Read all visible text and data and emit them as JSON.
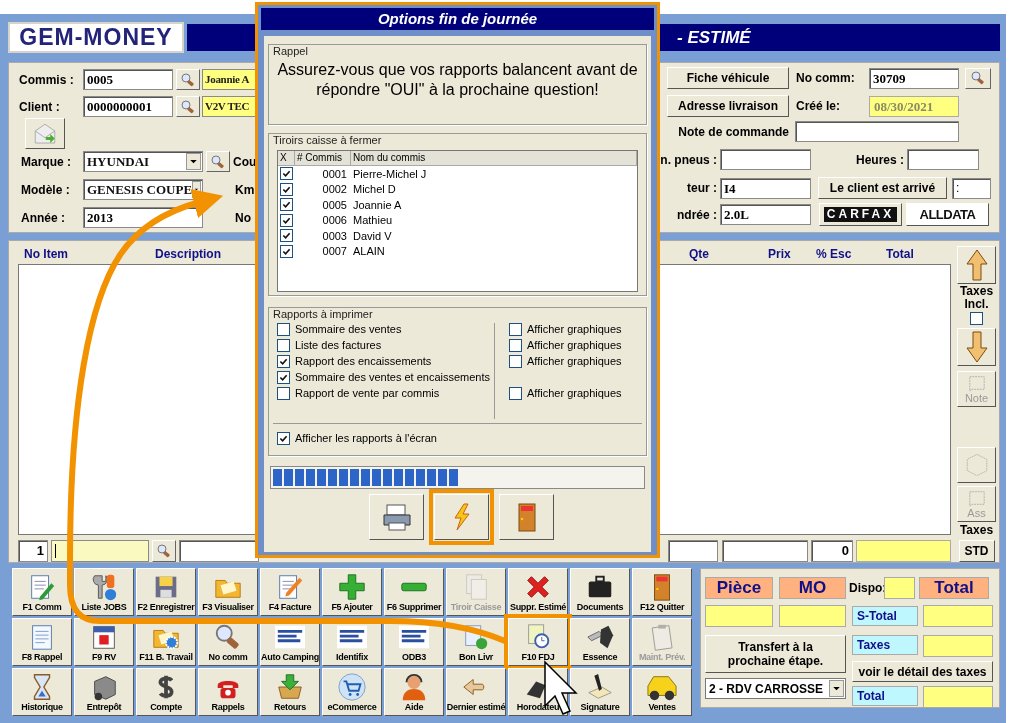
{
  "logo": {
    "text": "GEM-MONEY"
  },
  "title_bar": {
    "title": "- ESTIMÉ"
  },
  "left_form": {
    "commis": {
      "label": "Commis :",
      "value": "0005",
      "name": "Joannie A"
    },
    "client": {
      "label": "Client :",
      "value": "0000000001",
      "name": "V2V TEC"
    },
    "marque": {
      "label": "Marque :",
      "value": "HYUNDAI",
      "next_label": "Cou"
    },
    "modele": {
      "label": "Modèle :",
      "value": "GENESIS COUPE",
      "next_label": "Km"
    },
    "annee": {
      "label": "Année :",
      "value": "2013",
      "next_label": "No"
    }
  },
  "right_form": {
    "vehicle_button": "Fiche véhicule",
    "delivery_button": "Adresse livraison",
    "no_comm": {
      "label": "No comm:",
      "value": "30709"
    },
    "created": {
      "label": "Créé le:",
      "value": "08/30/2021"
    },
    "order_note": {
      "label": "Note de commande"
    },
    "tires": {
      "label": "n. pneus :"
    },
    "hours": {
      "label": "Heures :"
    },
    "engine": {
      "label": "teur :",
      "value": "I4"
    },
    "arrived_button": "Le client est arrivé",
    "arrived_time": ":",
    "displacement": {
      "label": "ndrée :",
      "value": "2.0L"
    },
    "carfax": "CARFAX",
    "alldata": "ALLDATA"
  },
  "items_table": {
    "columns_left": [
      "No Item",
      "Description"
    ],
    "columns_right": [
      "Qte",
      "Prix",
      "% Esc",
      "Total"
    ],
    "entry": {
      "line": "1",
      "discount_total": "0"
    }
  },
  "side_panel": {
    "taxes_incl": {
      "label": "Taxes Incl.",
      "checked": false
    },
    "note_button": {
      "label": "Note",
      "disabled": true
    },
    "ass_button": {
      "label": "Ass",
      "disabled": true
    },
    "taxes_label": "Taxes",
    "std_button": "STD"
  },
  "toolbar": [
    {
      "label": "F1 Comm",
      "disabled": false,
      "highlighted": false
    },
    {
      "label": "Liste JOBS",
      "disabled": false,
      "highlighted": false
    },
    {
      "label": "F2 Enregistrer",
      "disabled": false,
      "highlighted": false
    },
    {
      "label": "F3 Visualiser",
      "disabled": false,
      "highlighted": false
    },
    {
      "label": "F4 Facture",
      "disabled": false,
      "highlighted": false
    },
    {
      "label": "F5 Ajouter",
      "disabled": false,
      "highlighted": false
    },
    {
      "label": "F6 Supprimer",
      "disabled": false,
      "highlighted": false
    },
    {
      "label": "Tiroir Caisse",
      "disabled": true,
      "highlighted": false
    },
    {
      "label": "Suppr. Estimé",
      "disabled": false,
      "highlighted": false
    },
    {
      "label": "Documents",
      "disabled": false,
      "highlighted": false
    },
    {
      "label": "F12 Quitter",
      "disabled": false,
      "highlighted": false
    },
    {
      "label": "F8 Rappel",
      "disabled": false,
      "highlighted": false
    },
    {
      "label": "F9 RV",
      "disabled": false,
      "highlighted": false
    },
    {
      "label": "F11 B. Travail",
      "disabled": false,
      "highlighted": false
    },
    {
      "label": "No comm",
      "disabled": false,
      "highlighted": false
    },
    {
      "label": "Auto Camping",
      "disabled": false,
      "highlighted": false
    },
    {
      "label": "Identifix",
      "disabled": false,
      "highlighted": false
    },
    {
      "label": "ODB3",
      "disabled": false,
      "highlighted": false
    },
    {
      "label": "Bon Livr",
      "disabled": false,
      "highlighted": false
    },
    {
      "label": "F10 FDJ",
      "disabled": false,
      "highlighted": true
    },
    {
      "label": "Essence",
      "disabled": false,
      "highlighted": false
    },
    {
      "label": "Maint. Prév.",
      "disabled": true,
      "highlighted": false
    },
    {
      "label": "Historique",
      "disabled": false,
      "highlighted": false
    },
    {
      "label": "Entrepôt",
      "disabled": false,
      "highlighted": false
    },
    {
      "label": "Compte",
      "disabled": false,
      "highlighted": false
    },
    {
      "label": "Rappels",
      "disabled": false,
      "highlighted": false
    },
    {
      "label": "Retours",
      "disabled": false,
      "highlighted": false
    },
    {
      "label": "eCommerce",
      "disabled": false,
      "highlighted": false
    },
    {
      "label": "Aide",
      "disabled": false,
      "highlighted": false
    },
    {
      "label": "Dernier estimé",
      "disabled": false,
      "highlighted": false
    },
    {
      "label": "Horodateu",
      "disabled": false,
      "highlighted": false
    },
    {
      "label": "Signature",
      "disabled": false,
      "highlighted": false
    },
    {
      "label": "Ventes",
      "disabled": false,
      "highlighted": false
    }
  ],
  "totals": {
    "headers": [
      "Pièce",
      "MO",
      "Total"
    ],
    "dispo_label": "Dispo:",
    "subtotal_label": "S-Total",
    "taxes_label": "Taxes",
    "total_label": "Total",
    "transfer_button": "Transfert à la prochaine étape.",
    "tax_detail_button": "voir le détail des taxes",
    "stage_select": "2 - RDV CARROSSE"
  },
  "dialog": {
    "title": "Options fin de journée",
    "reminder": {
      "legend": "Rappel",
      "message": "Assurez-vous que vos rapports balancent avant de répondre \"OUI\" à la prochaine question!"
    },
    "drawers": {
      "legend": "Tiroirs caisse à fermer",
      "columns": [
        "X",
        "# Commis",
        "Nom du commis"
      ],
      "rows": [
        {
          "number": "0001",
          "name": "Pierre-Michel J",
          "checked": true
        },
        {
          "number": "0002",
          "name": "Michel D",
          "checked": true
        },
        {
          "number": "0005",
          "name": "Joannie A",
          "checked": true
        },
        {
          "number": "0006",
          "name": "Mathieu",
          "checked": true
        },
        {
          "number": "0003",
          "name": "David V",
          "checked": true
        },
        {
          "number": "0007",
          "name": "ALAIN",
          "checked": true
        }
      ]
    },
    "reports": {
      "legend": "Rapports à imprimer",
      "items": [
        {
          "label": "Sommaire des ventes",
          "checked": false,
          "graph": {
            "label": "Afficher graphiques",
            "checked": false
          }
        },
        {
          "label": "Liste des factures",
          "checked": false,
          "graph": {
            "label": "Afficher graphiques",
            "checked": false
          }
        },
        {
          "label": "Rapport des encaissements",
          "checked": true,
          "graph": {
            "label": "Afficher graphiques",
            "checked": false
          }
        },
        {
          "label": "Sommaire des ventes et encaissements",
          "checked": true
        },
        {
          "label": "Rapport de vente par commis",
          "checked": false,
          "graph": {
            "label": "Afficher graphiques",
            "checked": false
          }
        }
      ],
      "show_on_screen": {
        "label": "Afficher les rapports à l'écran",
        "checked": true
      }
    },
    "progress": {
      "level": 0.5
    },
    "buttons": [
      {
        "highlighted": false
      },
      {
        "highlighted": true
      },
      {
        "highlighted": false
      }
    ]
  }
}
